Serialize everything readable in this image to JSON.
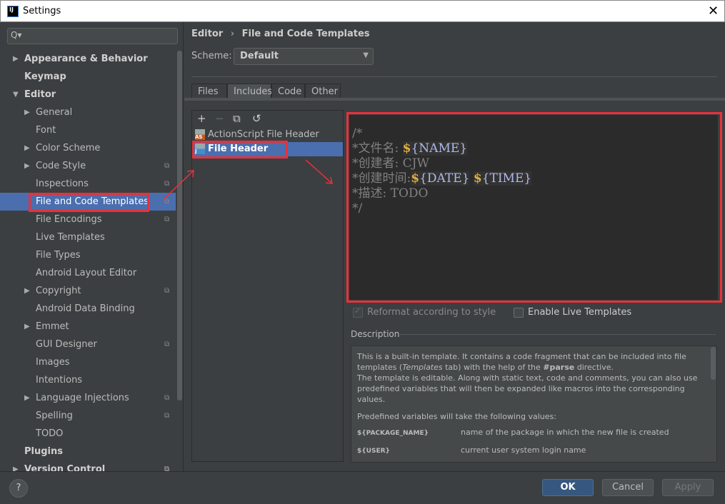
{
  "window": {
    "title": "Settings",
    "logo": "IJ",
    "close": "✕"
  },
  "sidebar": {
    "search_placeholder": "Q▾",
    "items": [
      {
        "label": "Appearance & Behavior",
        "level": 0,
        "arrow": "▶",
        "bold": true
      },
      {
        "label": "Keymap",
        "level": 0,
        "bold": true
      },
      {
        "label": "Editor",
        "level": 0,
        "arrow": "▼",
        "bold": true
      },
      {
        "label": "General",
        "level": 1,
        "arrow": "▶"
      },
      {
        "label": "Font",
        "level": 1
      },
      {
        "label": "Color Scheme",
        "level": 1,
        "arrow": "▶"
      },
      {
        "label": "Code Style",
        "level": 1,
        "arrow": "▶",
        "copy": true
      },
      {
        "label": "Inspections",
        "level": 1,
        "copy": true
      },
      {
        "label": "File and Code Templates",
        "level": 1,
        "copy": true,
        "selected": true
      },
      {
        "label": "File Encodings",
        "level": 1,
        "copy": true
      },
      {
        "label": "Live Templates",
        "level": 1
      },
      {
        "label": "File Types",
        "level": 1
      },
      {
        "label": "Android Layout Editor",
        "level": 1
      },
      {
        "label": "Copyright",
        "level": 1,
        "arrow": "▶",
        "copy": true
      },
      {
        "label": "Android Data Binding",
        "level": 1
      },
      {
        "label": "Emmet",
        "level": 1,
        "arrow": "▶"
      },
      {
        "label": "GUI Designer",
        "level": 1,
        "copy": true
      },
      {
        "label": "Images",
        "level": 1
      },
      {
        "label": "Intentions",
        "level": 1
      },
      {
        "label": "Language Injections",
        "level": 1,
        "arrow": "▶",
        "copy": true
      },
      {
        "label": "Spelling",
        "level": 1,
        "copy": true
      },
      {
        "label": "TODO",
        "level": 1
      },
      {
        "label": "Plugins",
        "level": 0,
        "bold": true
      },
      {
        "label": "Version Control",
        "level": 0,
        "arrow": "▶",
        "bold": true,
        "copy": true
      }
    ]
  },
  "breadcrumb": {
    "parent": "Editor",
    "sep": "›",
    "current": "File and Code Templates"
  },
  "scheme": {
    "label": "Scheme:",
    "value": "Default"
  },
  "tabs": [
    {
      "label": "Files"
    },
    {
      "label": "Includes",
      "active": true
    },
    {
      "label": "Code"
    },
    {
      "label": "Other"
    }
  ],
  "toolbar": {
    "add": "+",
    "remove": "−",
    "copy": "⧉",
    "reset": "↺"
  },
  "templates": [
    {
      "label": "ActionScript File Header",
      "icon": "AS",
      "icon_color": "#c75b1e"
    },
    {
      "label": "File Header",
      "icon": "J",
      "icon_color": "#3d8fd1",
      "selected": true
    }
  ],
  "editor": {
    "lines": [
      [
        {
          "t": "/*"
        }
      ],
      [
        {
          "t": "*文件名: "
        },
        {
          "d": "$"
        },
        {
          "v": "{NAME}"
        }
      ],
      [
        {
          "t": "*创建者: CJW"
        }
      ],
      [
        {
          "t": "*创建时间:"
        },
        {
          "d": "$"
        },
        {
          "v": "{DATE}"
        },
        {
          "t": " "
        },
        {
          "d": "$"
        },
        {
          "v": "{TIME}"
        }
      ],
      [
        {
          "t": "*描述: TODO"
        }
      ],
      [
        {
          "t": "*/"
        }
      ]
    ]
  },
  "options": {
    "reformat": {
      "label": "Reformat according to style",
      "checked": true,
      "disabled": true
    },
    "live": {
      "label": "Enable Live Templates",
      "checked": false
    }
  },
  "description": {
    "title": "Description",
    "p1a": "This is a built-in template. It contains a code fragment that can be included into file templates (",
    "p1i": "Templates",
    "p1b": " tab) with the help of the ",
    "p1c": "#parse",
    "p1d": " directive.",
    "p2": "The template is editable. Along with static text, code and comments, you can also use predefined variables that will then be expanded like macros into the corresponding values.",
    "p3": "Predefined variables will take the following values:",
    "vars": [
      {
        "name": "${PACKAGE_NAME}",
        "desc": "name of the package in which the new file is created"
      },
      {
        "name": "${USER}",
        "desc": "current user system login name"
      }
    ]
  },
  "buttons": {
    "help": "?",
    "ok": "OK",
    "cancel": "Cancel",
    "apply": "Apply"
  },
  "colors": {
    "accent": "#4b6eaf",
    "annotation": "#e8313a",
    "ok": "#365880"
  }
}
